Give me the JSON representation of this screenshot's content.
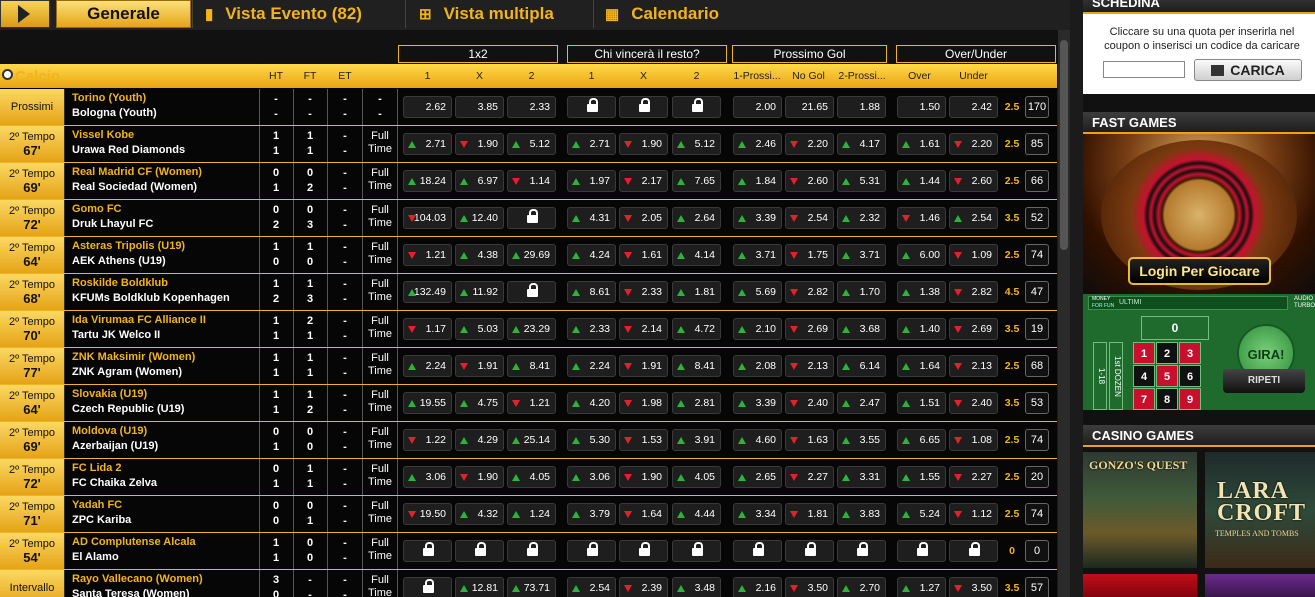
{
  "tabs": [
    {
      "label": "Generale",
      "active": true
    },
    {
      "label": "Vista Evento (82)",
      "icon": "book-icon"
    },
    {
      "label": "Vista multipla",
      "icon": "grid-icon"
    },
    {
      "label": "Calendario",
      "icon": "calendar-icon"
    }
  ],
  "sport": "Calcio",
  "groups": [
    "1x2",
    "Chi vincerà il resto?",
    "Prossimo Gol",
    "Over/Under"
  ],
  "columns": {
    "ht": "HT",
    "ft": "FT",
    "et": "ET",
    "m1": [
      "1",
      "X",
      "2"
    ],
    "m2": [
      "1",
      "X",
      "2"
    ],
    "m3": [
      "1-Prossi...",
      "No Gol",
      "2-Prossi..."
    ],
    "m4": [
      "Over",
      "Under"
    ]
  },
  "matches": [
    {
      "status": "Prossimi",
      "minute": "",
      "home": "Torino (Youth)",
      "away": "Bologna (Youth)",
      "ht": [
        "-",
        "-"
      ],
      "ft": [
        "-",
        "-"
      ],
      "et": [
        "-",
        "-"
      ],
      "ftlabel": "",
      "x12": [
        [
          "",
          "2.62"
        ],
        [
          "",
          "3.85"
        ],
        [
          "",
          "2.33"
        ]
      ],
      "rest": [
        [
          "L",
          ""
        ],
        [
          "L",
          ""
        ],
        [
          "L",
          ""
        ]
      ],
      "next": [
        [
          "",
          "2.00"
        ],
        [
          "",
          "21.65"
        ],
        [
          "",
          "1.88"
        ]
      ],
      "ou": [
        [
          "",
          "1.50"
        ],
        [
          "",
          "2.42"
        ]
      ],
      "line": "2.5",
      "more": "170"
    },
    {
      "status": "2º Tempo",
      "minute": "67'",
      "home": "Vissel Kobe",
      "away": "Urawa Red Diamonds",
      "ht": [
        "1",
        "1"
      ],
      "ft": [
        "1",
        "1"
      ],
      "et": [
        "-",
        "-"
      ],
      "ftlabel": "Full Time",
      "x12": [
        [
          "up",
          "2.71"
        ],
        [
          "dn",
          "1.90"
        ],
        [
          "up",
          "5.12"
        ]
      ],
      "rest": [
        [
          "up",
          "2.71"
        ],
        [
          "dn",
          "1.90"
        ],
        [
          "up",
          "5.12"
        ]
      ],
      "next": [
        [
          "up",
          "2.46"
        ],
        [
          "dn",
          "2.20"
        ],
        [
          "up",
          "4.17"
        ]
      ],
      "ou": [
        [
          "up",
          "1.61"
        ],
        [
          "dn",
          "2.20"
        ]
      ],
      "line": "2.5",
      "more": "85"
    },
    {
      "status": "2º Tempo",
      "minute": "69'",
      "home": "Real Madrid CF (Women)",
      "away": "Real Sociedad (Women)",
      "ht": [
        "0",
        "1"
      ],
      "ft": [
        "0",
        "2"
      ],
      "et": [
        "-",
        "-"
      ],
      "ftlabel": "Full Time",
      "x12": [
        [
          "up",
          "18.24"
        ],
        [
          "up",
          "6.97"
        ],
        [
          "dn",
          "1.14"
        ]
      ],
      "rest": [
        [
          "up",
          "1.97"
        ],
        [
          "dn",
          "2.17"
        ],
        [
          "up",
          "7.65"
        ]
      ],
      "next": [
        [
          "up",
          "1.84"
        ],
        [
          "dn",
          "2.60"
        ],
        [
          "up",
          "5.31"
        ]
      ],
      "ou": [
        [
          "up",
          "1.44"
        ],
        [
          "dn",
          "2.60"
        ]
      ],
      "line": "2.5",
      "more": "66"
    },
    {
      "status": "2º Tempo",
      "minute": "72'",
      "home": "Gomo FC",
      "away": "Druk Lhayul FC",
      "ht": [
        "0",
        "2"
      ],
      "ft": [
        "0",
        "3"
      ],
      "et": [
        "-",
        "-"
      ],
      "ftlabel": "Full Time",
      "x12": [
        [
          "dn",
          "104.03"
        ],
        [
          "up",
          "12.40"
        ],
        [
          "L",
          ""
        ]
      ],
      "rest": [
        [
          "up",
          "4.31"
        ],
        [
          "dn",
          "2.05"
        ],
        [
          "up",
          "2.64"
        ]
      ],
      "next": [
        [
          "up",
          "3.39"
        ],
        [
          "dn",
          "2.54"
        ],
        [
          "up",
          "2.32"
        ]
      ],
      "ou": [
        [
          "dn",
          "1.46"
        ],
        [
          "up",
          "2.54"
        ]
      ],
      "line": "3.5",
      "more": "52"
    },
    {
      "status": "2º Tempo",
      "minute": "64'",
      "home": "Asteras Tripolis (U19)",
      "away": "AEK Athens (U19)",
      "ht": [
        "1",
        "0"
      ],
      "ft": [
        "1",
        "0"
      ],
      "et": [
        "-",
        "-"
      ],
      "ftlabel": "Full Time",
      "x12": [
        [
          "dn",
          "1.21"
        ],
        [
          "up",
          "4.38"
        ],
        [
          "up",
          "29.69"
        ]
      ],
      "rest": [
        [
          "up",
          "4.24"
        ],
        [
          "dn",
          "1.61"
        ],
        [
          "up",
          "4.14"
        ]
      ],
      "next": [
        [
          "up",
          "3.71"
        ],
        [
          "dn",
          "1.75"
        ],
        [
          "up",
          "3.71"
        ]
      ],
      "ou": [
        [
          "up",
          "6.00"
        ],
        [
          "dn",
          "1.09"
        ]
      ],
      "line": "2.5",
      "more": "74"
    },
    {
      "status": "2º Tempo",
      "minute": "68'",
      "home": "Roskilde Boldklub",
      "away": "KFUMs Boldklub Kopenhagen",
      "ht": [
        "1",
        "2"
      ],
      "ft": [
        "1",
        "3"
      ],
      "et": [
        "-",
        "-"
      ],
      "ftlabel": "Full Time",
      "x12": [
        [
          "up",
          "132.49"
        ],
        [
          "up",
          "11.92"
        ],
        [
          "L",
          ""
        ]
      ],
      "rest": [
        [
          "up",
          "8.61"
        ],
        [
          "dn",
          "2.33"
        ],
        [
          "up",
          "1.81"
        ]
      ],
      "next": [
        [
          "up",
          "5.69"
        ],
        [
          "dn",
          "2.82"
        ],
        [
          "up",
          "1.70"
        ]
      ],
      "ou": [
        [
          "up",
          "1.38"
        ],
        [
          "dn",
          "2.82"
        ]
      ],
      "line": "4.5",
      "more": "47"
    },
    {
      "status": "2º Tempo",
      "minute": "70'",
      "home": "Ida Virumaa FC Alliance II",
      "away": "Tartu JK Welco II",
      "ht": [
        "1",
        "1"
      ],
      "ft": [
        "2",
        "1"
      ],
      "et": [
        "-",
        "-"
      ],
      "ftlabel": "Full Time",
      "x12": [
        [
          "dn",
          "1.17"
        ],
        [
          "up",
          "5.03"
        ],
        [
          "up",
          "23.29"
        ]
      ],
      "rest": [
        [
          "up",
          "2.33"
        ],
        [
          "dn",
          "2.14"
        ],
        [
          "up",
          "4.72"
        ]
      ],
      "next": [
        [
          "up",
          "2.10"
        ],
        [
          "dn",
          "2.69"
        ],
        [
          "up",
          "3.68"
        ]
      ],
      "ou": [
        [
          "up",
          "1.40"
        ],
        [
          "dn",
          "2.69"
        ]
      ],
      "line": "3.5",
      "more": "19"
    },
    {
      "status": "2º Tempo",
      "minute": "77'",
      "home": "ZNK Maksimir (Women)",
      "away": "ZNK Agram (Women)",
      "ht": [
        "1",
        "1"
      ],
      "ft": [
        "1",
        "1"
      ],
      "et": [
        "-",
        "-"
      ],
      "ftlabel": "Full Time",
      "x12": [
        [
          "up",
          "2.24"
        ],
        [
          "dn",
          "1.91"
        ],
        [
          "up",
          "8.41"
        ]
      ],
      "rest": [
        [
          "up",
          "2.24"
        ],
        [
          "dn",
          "1.91"
        ],
        [
          "up",
          "8.41"
        ]
      ],
      "next": [
        [
          "up",
          "2.08"
        ],
        [
          "dn",
          "2.13"
        ],
        [
          "up",
          "6.14"
        ]
      ],
      "ou": [
        [
          "up",
          "1.64"
        ],
        [
          "dn",
          "2.13"
        ]
      ],
      "line": "2.5",
      "more": "68"
    },
    {
      "status": "2º Tempo",
      "minute": "64'",
      "home": "Slovakia (U19)",
      "away": "Czech Republic (U19)",
      "ht": [
        "1",
        "1"
      ],
      "ft": [
        "1",
        "2"
      ],
      "et": [
        "-",
        "-"
      ],
      "ftlabel": "Full Time",
      "x12": [
        [
          "up",
          "19.55"
        ],
        [
          "up",
          "4.75"
        ],
        [
          "dn",
          "1.21"
        ]
      ],
      "rest": [
        [
          "up",
          "4.20"
        ],
        [
          "dn",
          "1.98"
        ],
        [
          "up",
          "2.81"
        ]
      ],
      "next": [
        [
          "up",
          "3.39"
        ],
        [
          "dn",
          "2.40"
        ],
        [
          "up",
          "2.47"
        ]
      ],
      "ou": [
        [
          "up",
          "1.51"
        ],
        [
          "dn",
          "2.40"
        ]
      ],
      "line": "3.5",
      "more": "53"
    },
    {
      "status": "2º Tempo",
      "minute": "69'",
      "home": "Moldova (U19)",
      "away": "Azerbaijan (U19)",
      "ht": [
        "0",
        "1"
      ],
      "ft": [
        "0",
        "0"
      ],
      "et": [
        "-",
        "-"
      ],
      "ftlabel": "Full Time",
      "x12": [
        [
          "dn",
          "1.22"
        ],
        [
          "up",
          "4.29"
        ],
        [
          "up",
          "25.14"
        ]
      ],
      "rest": [
        [
          "up",
          "5.30"
        ],
        [
          "dn",
          "1.53"
        ],
        [
          "up",
          "3.91"
        ]
      ],
      "next": [
        [
          "up",
          "4.60"
        ],
        [
          "dn",
          "1.63"
        ],
        [
          "up",
          "3.55"
        ]
      ],
      "ou": [
        [
          "up",
          "6.65"
        ],
        [
          "dn",
          "1.08"
        ]
      ],
      "line": "2.5",
      "more": "74"
    },
    {
      "status": "2º Tempo",
      "minute": "72'",
      "home": "FC Lida 2",
      "away": "FC Chaika Zelva",
      "ht": [
        "0",
        "1"
      ],
      "ft": [
        "1",
        "1"
      ],
      "et": [
        "-",
        "-"
      ],
      "ftlabel": "Full Time",
      "x12": [
        [
          "up",
          "3.06"
        ],
        [
          "dn",
          "1.90"
        ],
        [
          "up",
          "4.05"
        ]
      ],
      "rest": [
        [
          "up",
          "3.06"
        ],
        [
          "dn",
          "1.90"
        ],
        [
          "up",
          "4.05"
        ]
      ],
      "next": [
        [
          "up",
          "2.65"
        ],
        [
          "dn",
          "2.27"
        ],
        [
          "up",
          "3.31"
        ]
      ],
      "ou": [
        [
          "up",
          "1.55"
        ],
        [
          "dn",
          "2.27"
        ]
      ],
      "line": "2.5",
      "more": "20"
    },
    {
      "status": "2º Tempo",
      "minute": "71'",
      "home": "Yadah FC",
      "away": "ZPC Kariba",
      "ht": [
        "0",
        "0"
      ],
      "ft": [
        "0",
        "1"
      ],
      "et": [
        "-",
        "-"
      ],
      "ftlabel": "Full Time",
      "x12": [
        [
          "dn",
          "19.50"
        ],
        [
          "up",
          "4.32"
        ],
        [
          "up",
          "1.24"
        ]
      ],
      "rest": [
        [
          "up",
          "3.79"
        ],
        [
          "dn",
          "1.64"
        ],
        [
          "up",
          "4.44"
        ]
      ],
      "next": [
        [
          "up",
          "3.34"
        ],
        [
          "dn",
          "1.81"
        ],
        [
          "up",
          "3.83"
        ]
      ],
      "ou": [
        [
          "up",
          "5.24"
        ],
        [
          "dn",
          "1.12"
        ]
      ],
      "line": "2.5",
      "more": "74"
    },
    {
      "status": "2º Tempo",
      "minute": "54'",
      "home": "AD Complutense Alcala",
      "away": "El Alamo",
      "ht": [
        "1",
        "1"
      ],
      "ft": [
        "0",
        "0"
      ],
      "et": [
        "-",
        "-"
      ],
      "ftlabel": "Full Time",
      "x12": [
        [
          "L",
          ""
        ],
        [
          "L",
          ""
        ],
        [
          "L",
          ""
        ]
      ],
      "rest": [
        [
          "L",
          ""
        ],
        [
          "L",
          ""
        ],
        [
          "L",
          ""
        ]
      ],
      "next": [
        [
          "L",
          ""
        ],
        [
          "L",
          ""
        ],
        [
          "L",
          ""
        ]
      ],
      "ou": [
        [
          "L",
          ""
        ],
        [
          "L",
          ""
        ]
      ],
      "line": "0",
      "more": "0"
    },
    {
      "status": "Intervallo",
      "minute": "",
      "home": "Rayo Vallecano (Women)",
      "away": "Santa Teresa (Women)",
      "ht": [
        "3",
        "0"
      ],
      "ft": [
        "-",
        "-"
      ],
      "et": [
        "-",
        "-"
      ],
      "ftlabel": "Full Time",
      "x12": [
        [
          "L",
          ""
        ],
        [
          "up",
          "12.81"
        ],
        [
          "up",
          "73.71"
        ]
      ],
      "rest": [
        [
          "up",
          "2.54"
        ],
        [
          "dn",
          "2.39"
        ],
        [
          "up",
          "3.48"
        ]
      ],
      "next": [
        [
          "up",
          "2.16"
        ],
        [
          "dn",
          "3.50"
        ],
        [
          "up",
          "2.70"
        ]
      ],
      "ou": [
        [
          "up",
          "1.27"
        ],
        [
          "dn",
          "3.50"
        ]
      ],
      "line": "3.5",
      "more": "57"
    }
  ],
  "sidebar": {
    "schedina": {
      "title": "SCHEDINA",
      "text": "Cliccare su una quota per inserirla nel coupon o inserisci un codice da caricare",
      "input_value": "",
      "button": "CARICA"
    },
    "fast_games": {
      "title": "FAST GAMES",
      "login": "Login Per Giocare",
      "gira": "GIRA!",
      "ripeti": "RIPETI",
      "money": "MONEY",
      "forfun": "FOR FUN",
      "ultimi": "ULTIMI",
      "audio": "AUDIO",
      "turbo": "TURBO",
      "zero": "0",
      "dozen": "1st DOZEN",
      "range": "1-18",
      "numbers": [
        [
          "1",
          "red"
        ],
        [
          "2",
          "blk"
        ],
        [
          "3",
          "red"
        ],
        [
          "4",
          "blk"
        ],
        [
          "5",
          "red"
        ],
        [
          "6",
          "blk"
        ],
        [
          "7",
          "red"
        ],
        [
          "8",
          "blk"
        ],
        [
          "9",
          "red"
        ]
      ]
    },
    "casino_games": {
      "title": "CASINO GAMES",
      "games": [
        {
          "title": "GONZO'S QUEST"
        },
        {
          "title": "LARA CROFT",
          "sub": "TEMPLES AND TOMBS"
        },
        {
          "title": ""
        },
        {
          "title": ""
        }
      ]
    }
  }
}
